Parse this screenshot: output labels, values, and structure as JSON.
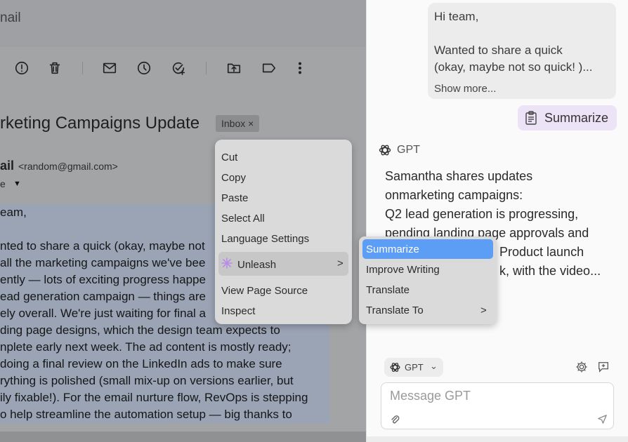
{
  "gmail": {
    "title_fragment": "nail",
    "toolbar_icons": [
      "report-spam-icon",
      "delete-icon",
      "mark-unread-icon",
      "snooze-icon",
      "add-task-icon",
      "move-to-icon",
      "label-icon",
      "more-vert-icon"
    ],
    "subject": "rketing Campaigns Update",
    "label_badge": "Inbox ×",
    "sender_name": "ail",
    "sender_email": "<random@gmail.com>",
    "to_fragment": "e",
    "body_lines": [
      "eam,",
      "",
      "nted to share a quick (okay, maybe not",
      "all the marketing campaigns we've bee",
      "ently — lots of exciting progress happe",
      "ead generation campaign — things are",
      "ely overall. We're just waiting for final a",
      "ding page designs, which the design team expects to",
      "nplete early next week. The ad content is mostly ready;",
      "doing a final review on the LinkedIn ads to make sure",
      "rything is polished (small mix-up on versions earlier, but",
      "ily fixable!). For the email nurture flow, RevOps is stepping",
      "o help streamline the automation setup — big thanks to"
    ]
  },
  "context_menu": {
    "items": [
      "Cut",
      "Copy",
      "Paste",
      "Select All",
      "Language Settings"
    ],
    "highlighted": "Unleash",
    "bottom_items": [
      "View Page Source",
      "Inspect"
    ],
    "arrow": ">"
  },
  "submenu": {
    "items": [
      "Summarize",
      "Improve Writing",
      "Translate",
      "Translate To"
    ],
    "active": "Summarize",
    "arrow": ">"
  },
  "panel": {
    "user_message_lines": [
      "Hi team,",
      "",
      "Wanted to share a quick",
      "(okay, maybe not so quick! )..."
    ],
    "show_more": "Show more...",
    "summarize_button": "Summarize",
    "assistant_name": "GPT",
    "response_lines": [
      "Samantha shares updates",
      "onmarketing campaigns:",
      "Q2 lead generation is progressing,",
      "pending landing page approvals and",
      "Product launch",
      "k, with the video..."
    ],
    "model_selector": "GPT",
    "model_caret": "⌄",
    "input_placeholder": "Message GPT"
  },
  "colors": {
    "overlay": "#9ea0a3",
    "submenu_highlight": "#5c9df5",
    "summarize_bg": "#ece3f6"
  }
}
